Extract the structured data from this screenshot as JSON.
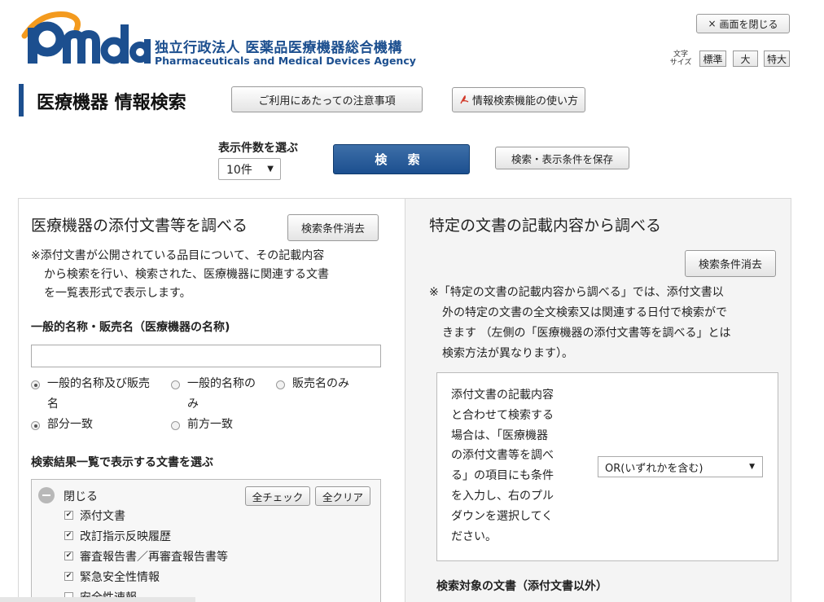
{
  "header": {
    "logo_jp": "独立行政法人 医薬品医療機器総合機構",
    "logo_en": "Pharmaceuticals and Medical Devices Agency",
    "brand_color": "#1c4f8f",
    "close_label": "画面を閉じる",
    "font_size_label": "文字サイズ",
    "font_sizes": [
      "標準",
      "大",
      "特大"
    ]
  },
  "title": {
    "text": "医療機器 情報検索",
    "notice_button": "ご利用にあたっての注意事項",
    "howto_button": "情報検索機能の使い方"
  },
  "controls": {
    "count_label": "表示件数を選ぶ",
    "count_value": "10件",
    "search_button": "検 索",
    "save_button": "検索・表示条件を保存"
  },
  "left_panel": {
    "heading": "医療機器の添付文書等を調べる",
    "clear_button": "検索条件消去",
    "note_lines": [
      "※添付文書が公開されている品目について、その記載内容",
      "から検索を行い、検索された、医療機器に関連する文書",
      "を一覧表形式で表示します。"
    ],
    "name_heading": "一般的名称・販売名（医療機器の名称)",
    "name_input_value": "",
    "radio_target": [
      {
        "label_l1": "一般的名称及び販売",
        "label_l2": "名",
        "checked": true
      },
      {
        "label_l1": "一般的名称の",
        "label_l2": "み",
        "checked": false
      },
      {
        "label_l1": "販売名のみ",
        "label_l2": "",
        "checked": false
      }
    ],
    "radio_match": [
      {
        "label": "部分一致",
        "checked": true
      },
      {
        "label": "前方一致",
        "checked": false
      }
    ],
    "doc_heading": "検索結果一覧で表示する文書を選ぶ",
    "collapse_label": "閉じる",
    "check_all": "全チェック",
    "clear_all": "全クリア",
    "documents": [
      {
        "label": "添付文書",
        "checked": true
      },
      {
        "label": "改訂指示反映履歴",
        "checked": true
      },
      {
        "label": "審査報告書／再審査報告書等",
        "checked": true
      },
      {
        "label": "緊急安全性情報",
        "checked": true
      },
      {
        "label": "安全性速報",
        "checked": false
      }
    ]
  },
  "right_panel": {
    "heading": "特定の文書の記載内容から調べる",
    "clear_button": "検索条件消去",
    "note_lines": [
      "※「特定の文書の記載内容から調べる」では、添付文書以",
      "外の特定の文書の全文検索又は関連する日付で検索がで",
      "きます （左側の「医療機器の添付文書等を調べる」とは",
      "検索方法が異なります）。"
    ],
    "box_lines": [
      "添付文書の記載内容",
      "と合わせて検索する",
      "場合は、「医療機器",
      "の添付文書等を調べ",
      "る」の項目にも条件",
      "を入力し、右のプル",
      "ダウンを選択してく",
      "ださい。"
    ],
    "or_select_value": "OR(いずれかを含む)",
    "target_heading": "検索対象の文書（添付文書以外）"
  }
}
